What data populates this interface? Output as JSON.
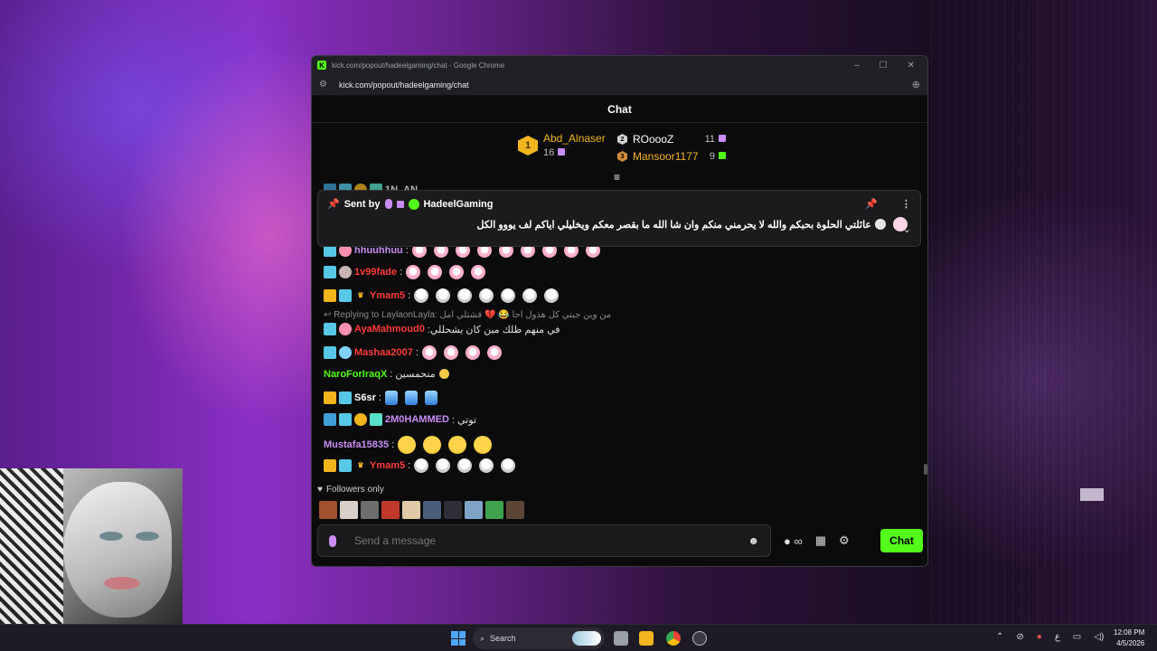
{
  "window": {
    "title": "kick.com/popout/hadeelgaming/chat - Google Chrome",
    "url": "kick.com/popout/hadeelgaming/chat"
  },
  "chat": {
    "header": "Chat",
    "leaderboard": {
      "first": {
        "rank": "1",
        "name": "Abd_Alnaser",
        "count": "16"
      },
      "second": {
        "name": "ROoooZ",
        "count": "11"
      },
      "third": {
        "name": "Mansoor1177",
        "count": "9"
      }
    },
    "pinned": {
      "label": "Sent by",
      "author": "HadeelGaming",
      "text": "عائلتي الحلوة بحبكم والله لا يحرمني منكم وان شا الله ما بقصر معكم ويخليلي اياكم لف يووو الكل"
    },
    "partial_top_user": "1N_AN",
    "messages": [
      {
        "user": "hhuuhhuu",
        "text": ":"
      },
      {
        "user": "1v99fade",
        "text": ":"
      },
      {
        "user": "Ymam5",
        "text": ":"
      },
      {
        "user": "AyaMahmoud0",
        "text": ":في منهم ظلك مين كان يشحللي"
      },
      {
        "user": "Mashaa2007",
        "text": ":"
      },
      {
        "user": "NaroForIraqX",
        "text": ": منحمسين"
      },
      {
        "user": "S6sr",
        "text": ":"
      },
      {
        "user": "2M0HAMMED",
        "text": ": توتي"
      },
      {
        "user": "Mustafa15835",
        "text": ":"
      },
      {
        "user": "Ymam5",
        "text": ":"
      }
    ],
    "reply": "↩ Replying to LaylaonLayla: من وين جبتي كل هذول احا 😂 💔 قشتلي امل",
    "followers_only": "Followers only",
    "input_placeholder": "Send a message",
    "send_label": "Chat",
    "colors": {
      "accent": "#53fc18",
      "gold": "#f2b51d"
    }
  },
  "taskbar": {
    "search": "Search",
    "lang": "ع",
    "time": "12:08 PM",
    "date": "4/5/2026"
  }
}
